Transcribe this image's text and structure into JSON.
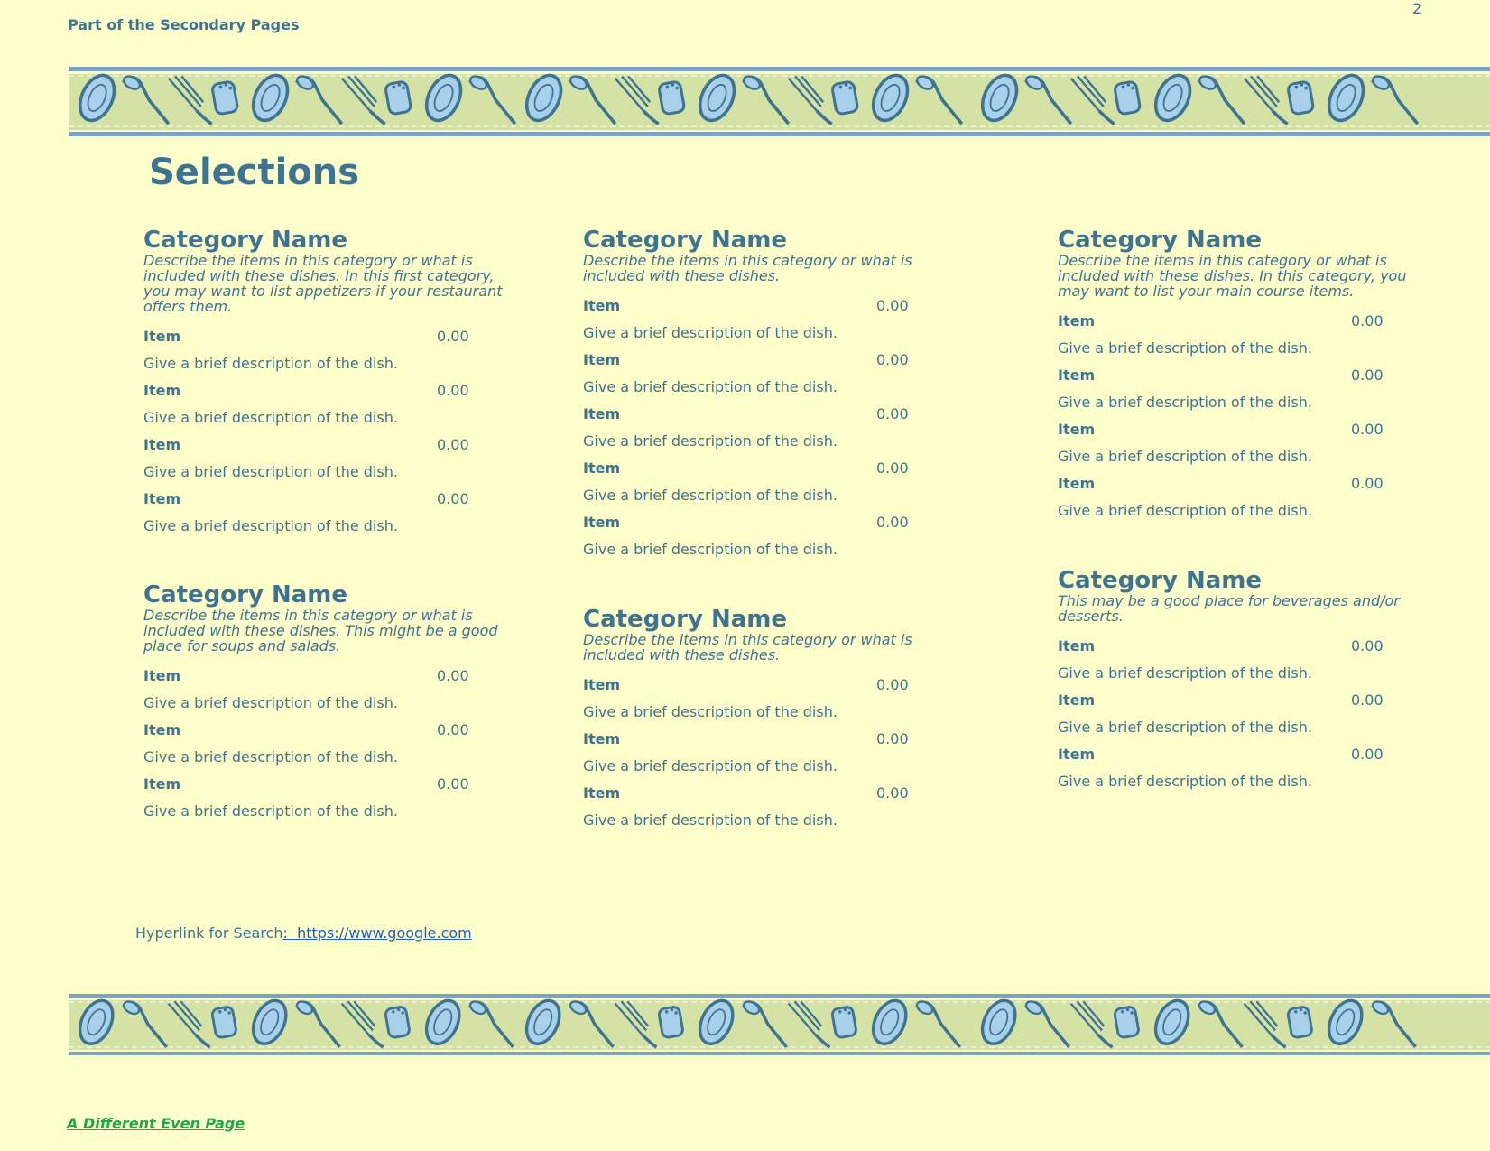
{
  "header": {
    "label": "Part of the Secondary Pages",
    "page_number": "2"
  },
  "title": "Selections",
  "columns": [
    {
      "categories": [
        {
          "name": "Category Name",
          "description": "Describe the items in this category or what is included with these dishes. In this first category, you may want to list appetizers if your restaurant offers them.",
          "items": [
            {
              "name": "Item",
              "price": "0.00",
              "desc": "Give a brief description of the dish."
            },
            {
              "name": "Item",
              "price": "0.00",
              "desc": "Give a brief description of the dish."
            },
            {
              "name": "Item",
              "price": "0.00",
              "desc": "Give a brief description of the dish."
            },
            {
              "name": "Item",
              "price": "0.00",
              "desc": "Give a brief description of the dish."
            }
          ]
        },
        {
          "name": "Category Name",
          "description": "Describe the items in this category or what is included with these dishes. This might be a good place for soups and salads.",
          "items": [
            {
              "name": "Item",
              "price": "0.00",
              "desc": "Give a brief description of the dish."
            },
            {
              "name": "Item",
              "price": "0.00",
              "desc": "Give a brief description of the dish."
            },
            {
              "name": "Item",
              "price": "0.00",
              "desc": "Give a brief description of the dish."
            }
          ]
        }
      ]
    },
    {
      "categories": [
        {
          "name": "Category Name",
          "description": "Describe the items in this category or what is included with these dishes.",
          "items": [
            {
              "name": "Item",
              "price": "0.00",
              "desc": "Give a brief description of the dish."
            },
            {
              "name": "Item",
              "price": "0.00",
              "desc": "Give a brief description of the dish."
            },
            {
              "name": "Item",
              "price": "0.00",
              "desc": "Give a brief description of the dish."
            },
            {
              "name": "Item",
              "price": "0.00",
              "desc": "Give a brief description of the dish."
            },
            {
              "name": "Item",
              "price": "0.00",
              "desc": "Give a brief description of the dish."
            }
          ]
        },
        {
          "name": "Category Name",
          "description": "Describe the items in this category or what is included with these dishes.",
          "items": [
            {
              "name": "Item",
              "price": "0.00",
              "desc": "Give a brief description of the dish."
            },
            {
              "name": "Item",
              "price": "0.00",
              "desc": "Give a brief description of the dish."
            },
            {
              "name": "Item",
              "price": "0.00",
              "desc": "Give a brief description of the dish."
            }
          ]
        }
      ]
    },
    {
      "categories": [
        {
          "name": "Category Name",
          "description": "Describe the items in this category or what is included with these dishes. In this category, you may want to list your main course items.",
          "items": [
            {
              "name": "Item",
              "price": "0.00",
              "desc": "Give a brief description of the dish."
            },
            {
              "name": "Item",
              "price": "0.00",
              "desc": "Give a brief description of the dish."
            },
            {
              "name": "Item",
              "price": "0.00",
              "desc": "Give a brief description of the dish."
            },
            {
              "name": "Item",
              "price": "0.00",
              "desc": "Give a brief description of the dish."
            }
          ]
        },
        {
          "name": "Category Name",
          "description": "This may be a good place for beverages and/or desserts.",
          "items": [
            {
              "name": "Item",
              "price": "0.00",
              "desc": "Give a brief description of the dish."
            },
            {
              "name": "Item",
              "price": "0.00",
              "desc": "Give a brief description of the dish."
            },
            {
              "name": "Item",
              "price": "0.00",
              "desc": "Give a brief description of the dish."
            }
          ]
        }
      ]
    }
  ],
  "hyperlink": {
    "label": "Hyperlink for Search",
    "colon": ":",
    "url_text": "https://www.google.com"
  },
  "footer_link": "A Different Even Page",
  "colors": {
    "background": "#FFFFCC",
    "text": "#3E7491",
    "banner_green": "#D4E2A6",
    "banner_blue": "#7BA3C4",
    "link_blue": "#1F5FBF",
    "footer_green": "#1FA84A"
  },
  "icons": [
    "plate-icon",
    "spoon-icon",
    "fork-icon",
    "salt-shaker-icon"
  ]
}
